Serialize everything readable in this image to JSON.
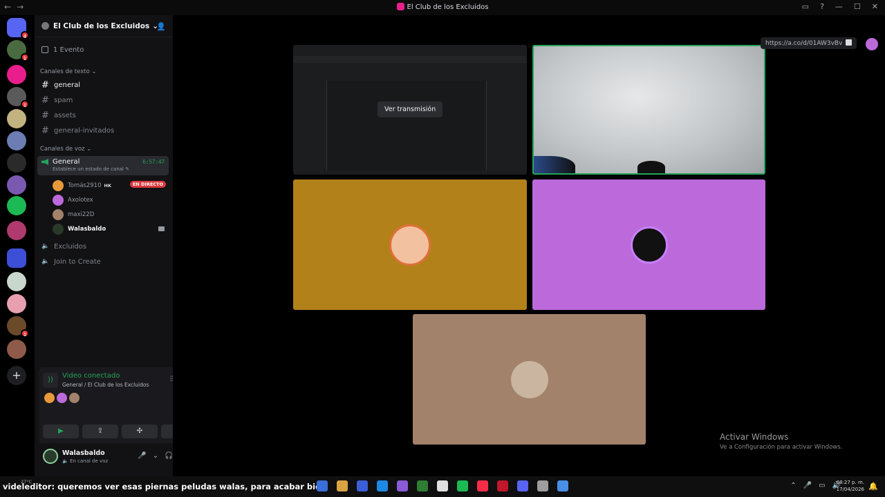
{
  "window": {
    "title": "El Club de los Excluidos",
    "nav_back": "←",
    "nav_forward": "→",
    "controls": [
      "▭",
      "?",
      "—",
      "☐",
      "✕"
    ]
  },
  "server_rail": {
    "items": [
      {
        "name": "discord-home",
        "color": "#5865f2",
        "badge": "4"
      },
      {
        "name": "server-1",
        "color": "#4a6b3f",
        "badge": "1"
      },
      {
        "name": "server-2",
        "color": "#e91e8c",
        "badge": ""
      },
      {
        "name": "server-3",
        "color": "#5a5a5a",
        "badge": "1"
      },
      {
        "name": "server-4",
        "color": "#c2b280",
        "badge": ""
      },
      {
        "name": "server-5",
        "color": "#6b7db3",
        "badge": ""
      },
      {
        "name": "server-6",
        "color": "#2a2a2a",
        "badge": ""
      },
      {
        "name": "server-7",
        "color": "#7a5ab0",
        "badge": ""
      },
      {
        "name": "server-8",
        "color": "#1db954",
        "badge": ""
      },
      {
        "name": "server-9",
        "color": "#b03a6e",
        "badge": ""
      },
      {
        "name": "folder-1",
        "color": "#3d4fd6",
        "badge": ""
      },
      {
        "name": "server-10",
        "color": "#c9d6cc",
        "badge": ""
      },
      {
        "name": "server-11",
        "color": "#e8a0b0",
        "badge": ""
      },
      {
        "name": "server-12",
        "color": "#6b4a2a",
        "badge": "1"
      },
      {
        "name": "server-13",
        "color": "#8f5a4a",
        "badge": ""
      }
    ],
    "add_server": "+"
  },
  "sidebar": {
    "guild_name": "El Club de los Excluidos",
    "guild_chevron": "⌄",
    "events_label": "1 Evento",
    "text_category": "Canales de texto",
    "text_channels": [
      {
        "name": "general",
        "active": true
      },
      {
        "name": "spam",
        "active": false
      },
      {
        "name": "assets",
        "active": false
      },
      {
        "name": "general-invitados",
        "active": false
      }
    ],
    "voice_category": "Canales de voz",
    "voice_channel": {
      "name": "General",
      "timer": "6:57:47",
      "status_hint": "Establece un estado de canal ✎"
    },
    "voice_users": [
      {
        "name": "Tomás2910",
        "color": "#e89a3a",
        "tag": "HK",
        "live_label": "EN DIRECTO"
      },
      {
        "name": "Axolotex",
        "color": "#bc6adb"
      },
      {
        "name": "maxi22D",
        "color": "#a2826a"
      },
      {
        "name": "Walasbaldo",
        "color": "#2a3a2a",
        "me": true
      }
    ],
    "other_voice_channels": [
      "Excluidos",
      "Join to Create"
    ]
  },
  "voice_panel": {
    "title": "Video conectado",
    "subtitle": "General / El Club de los Excluidos",
    "buttons": [
      "▶",
      "⇪",
      "✣",
      "✺"
    ]
  },
  "user_bar": {
    "name": "Walasbaldo",
    "status": "🔈 En canal de voz",
    "controls": [
      "🎤",
      "⌄",
      "🎧",
      "⌄",
      "⚙"
    ]
  },
  "stage": {
    "watch_stream_label": "Ver transmisión",
    "link_url": "https://a.co/d/01AW3vBv",
    "activate_title": "Activar Windows",
    "activate_sub": "Ve a Configuración para activar Windows."
  },
  "taskbar": {
    "weather": "27°C",
    "ticker_user": "videleditor",
    "ticker_text": ": queremos ver esas piernas peludas walas, para acabar bien",
    "apps": [
      "#3a6fd8",
      "#d9a441",
      "#3a5fd6",
      "#1e88e5",
      "#8a5bd6",
      "#2e7d32",
      "#e0e0e0",
      "#1db954",
      "#fa2d48",
      "#c0182a",
      "#5865f2",
      "#9e9e9e",
      "#4a8fe7"
    ],
    "tray": [
      "⌃",
      "🎤",
      "▭",
      "🔊"
    ],
    "time": "08:27 p. m.",
    "date": "17/04/2026",
    "bell": "🔔"
  }
}
